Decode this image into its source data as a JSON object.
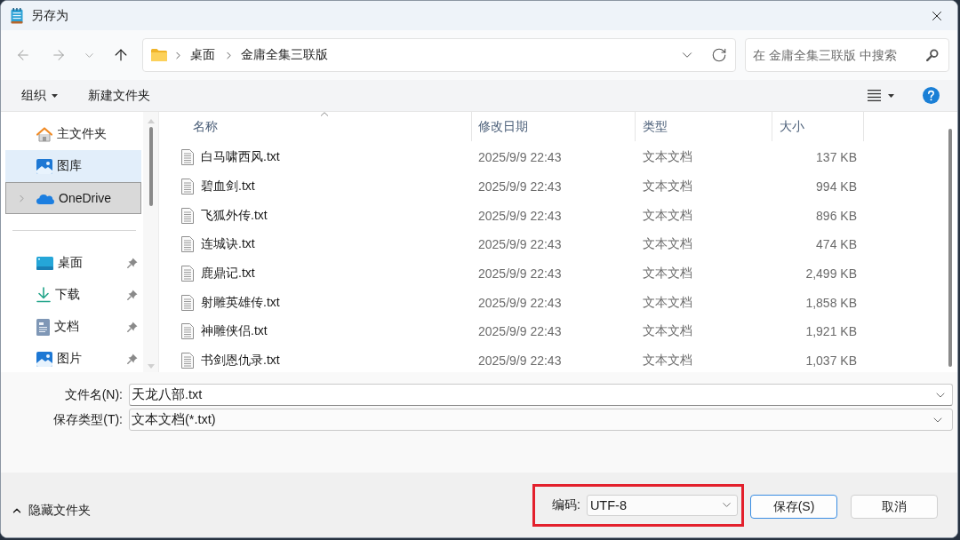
{
  "window": {
    "title": "另存为"
  },
  "navigation": {
    "buttons": [
      {
        "kind": "back",
        "disabled": true
      },
      {
        "kind": "forward",
        "disabled": true
      },
      {
        "kind": "recent",
        "disabled": true
      },
      {
        "kind": "up",
        "disabled": false
      }
    ],
    "breadcrumbs": [
      "桌面",
      "金庸全集三联版"
    ],
    "search": {
      "placeholder": "在 金庸全集三联版 中搜索"
    }
  },
  "toolbar": {
    "organize": "组织",
    "new_folder": "新建文件夹"
  },
  "sidebar": {
    "groups": [
      {
        "items": [
          {
            "label": "主文件夹",
            "kind": "home",
            "expandable": false,
            "pinned": false,
            "selected": false,
            "focused": false
          },
          {
            "label": "图库",
            "kind": "gallery",
            "expandable": false,
            "pinned": false,
            "selected": true,
            "focused": false
          },
          {
            "label": "OneDrive",
            "kind": "cloud",
            "expandable": true,
            "pinned": false,
            "selected": false,
            "focused": true
          }
        ]
      },
      {
        "items": [
          {
            "label": "桌面",
            "kind": "desktop",
            "expandable": false,
            "pinned": true,
            "selected": false,
            "focused": false
          },
          {
            "label": "下载",
            "kind": "download",
            "expandable": false,
            "pinned": true,
            "selected": false,
            "focused": false
          },
          {
            "label": "文档",
            "kind": "documents",
            "expandable": false,
            "pinned": true,
            "selected": false,
            "focused": false
          },
          {
            "label": "图片",
            "kind": "pictures",
            "expandable": false,
            "pinned": true,
            "selected": false,
            "focused": false
          }
        ]
      }
    ]
  },
  "file_list": {
    "columns": [
      {
        "label": "名称",
        "sorted": true
      },
      {
        "label": "修改日期",
        "sorted": false
      },
      {
        "label": "类型",
        "sorted": false
      },
      {
        "label": "大小",
        "sorted": false
      }
    ],
    "rows": [
      {
        "name": "白马啸西风.txt",
        "modified": "2025/9/9 22:43",
        "type": "文本文档",
        "size": "137 KB"
      },
      {
        "name": "碧血剑.txt",
        "modified": "2025/9/9 22:43",
        "type": "文本文档",
        "size": "994 KB"
      },
      {
        "name": "飞狐外传.txt",
        "modified": "2025/9/9 22:43",
        "type": "文本文档",
        "size": "896 KB"
      },
      {
        "name": "连城诀.txt",
        "modified": "2025/9/9 22:43",
        "type": "文本文档",
        "size": "474 KB"
      },
      {
        "name": "鹿鼎记.txt",
        "modified": "2025/9/9 22:43",
        "type": "文本文档",
        "size": "2,499 KB"
      },
      {
        "name": "射雕英雄传.txt",
        "modified": "2025/9/9 22:43",
        "type": "文本文档",
        "size": "1,858 KB"
      },
      {
        "name": "神雕侠侣.txt",
        "modified": "2025/9/9 22:43",
        "type": "文本文档",
        "size": "1,921 KB"
      },
      {
        "name": "书剑恩仇录.txt",
        "modified": "2025/9/9 22:43",
        "type": "文本文档",
        "size": "1,037 KB"
      }
    ]
  },
  "save_form": {
    "fields": [
      {
        "label": "文件名(N):",
        "value": "天龙八部.txt",
        "kind": "editable"
      },
      {
        "label": "保存类型(T):",
        "value": "文本文档(*.txt)",
        "kind": "dropdown"
      }
    ]
  },
  "footer": {
    "hide_folders": "隐藏文件夹",
    "encoding": {
      "label": "编码:",
      "value": "UTF-8",
      "highlighted": true
    },
    "buttons": [
      {
        "label": "保存(S)",
        "default": true
      },
      {
        "label": "取消",
        "default": false
      }
    ]
  }
}
